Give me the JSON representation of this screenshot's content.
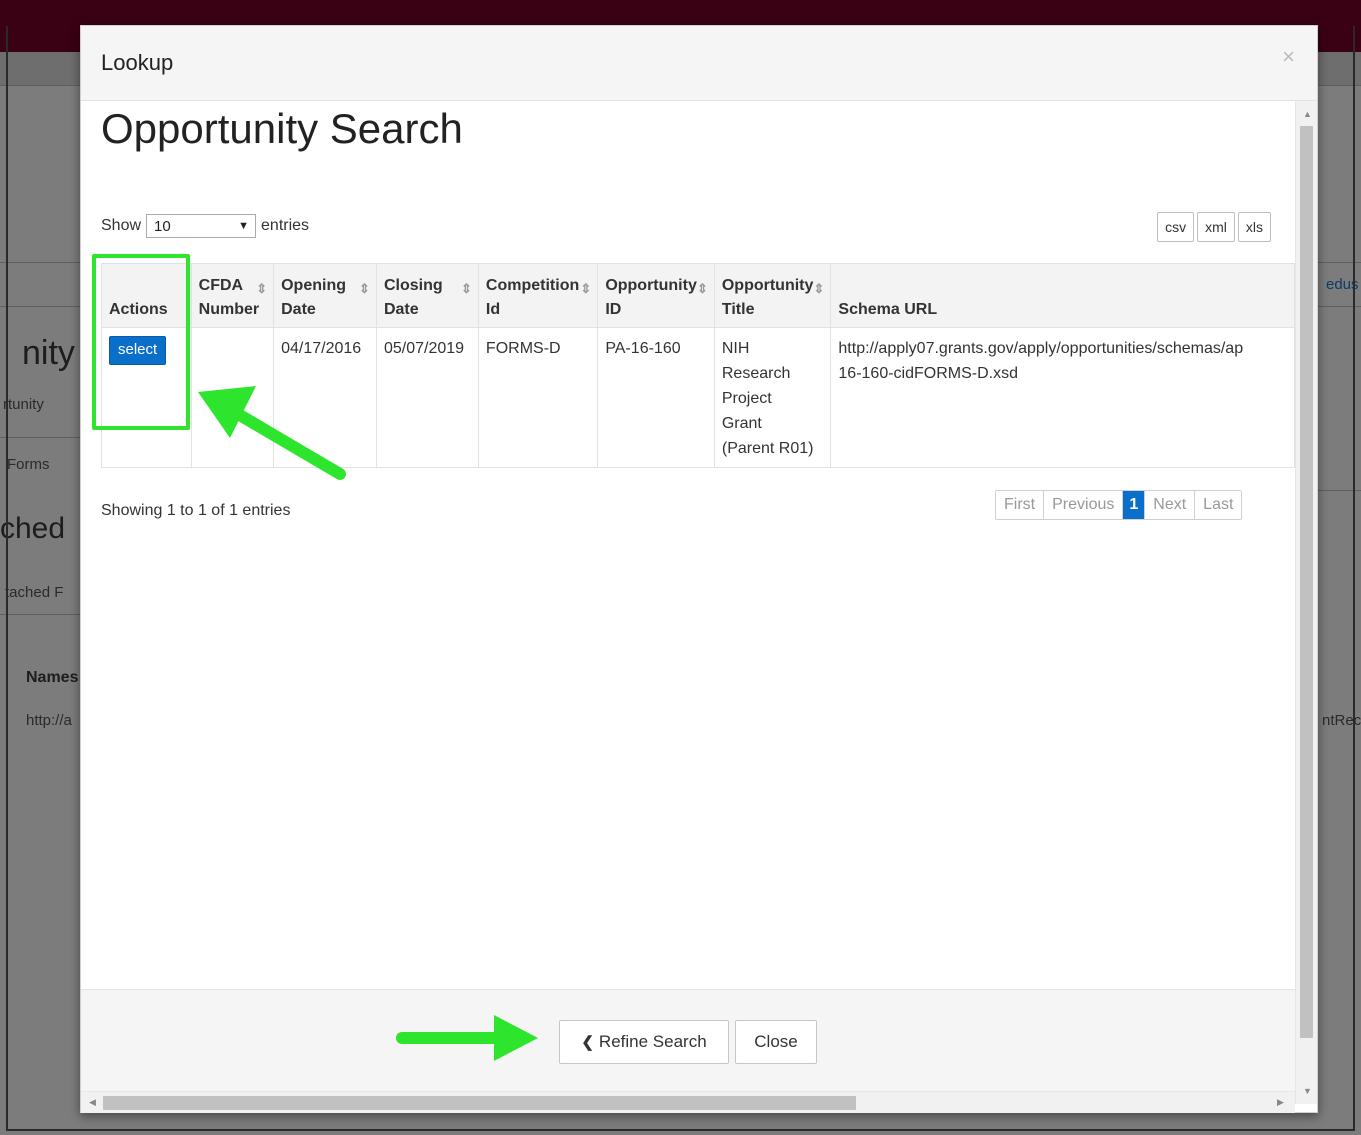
{
  "background": {
    "heading_fragment": "nity",
    "sub_fragment_1": "rtunity",
    "sub_fragment_2": "Forms",
    "section_fragment": "ched",
    "section_sub_fragment": "tached F",
    "column_fragment": "Names",
    "link_fragment": "http://a",
    "right_link_fragment": "edus",
    "right_text_fragment": "ntRec"
  },
  "modal": {
    "title": "Lookup",
    "close_glyph": "×",
    "page_title": "Opportunity Search"
  },
  "length_control": {
    "show_label": "Show",
    "selected": "10",
    "entries_label": "entries"
  },
  "export_buttons": [
    "csv",
    "xml",
    "xls"
  ],
  "table": {
    "columns": [
      {
        "line1": "Actions",
        "line2": ""
      },
      {
        "line1": "CFDA",
        "line2": "Number"
      },
      {
        "line1": "Opening",
        "line2": "Date"
      },
      {
        "line1": "Closing",
        "line2": "Date"
      },
      {
        "line1": "Competition",
        "line2": "Id"
      },
      {
        "line1": "Opportunity",
        "line2": "ID"
      },
      {
        "line1": "Opportunity",
        "line2": "Title"
      },
      {
        "line1": "Schema URL",
        "line2": ""
      }
    ],
    "rows": [
      {
        "action": "select",
        "cfda_number": "",
        "opening_date": "04/17/2016",
        "closing_date": "05/07/2019",
        "competition_id": "FORMS-D",
        "opportunity_id": "PA-16-160",
        "title_lines": [
          "NIH",
          "Research",
          "Project",
          "Grant",
          "(Parent R01)"
        ],
        "schema_url_line1": "http://apply07.grants.gov/apply/opportunities/schemas/ap",
        "schema_url_line2": "16-160-cidFORMS-D.xsd"
      }
    ]
  },
  "info": "Showing 1 to 1 of 1 entries",
  "pagination": {
    "first": "First",
    "previous": "Previous",
    "current": "1",
    "next": "Next",
    "last": "Last"
  },
  "footer": {
    "refine_label": "Refine Search",
    "close_label": "Close"
  },
  "colors": {
    "primary": "#0a6fc9",
    "highlight": "#2ee52e",
    "topbar": "#3a0014"
  }
}
